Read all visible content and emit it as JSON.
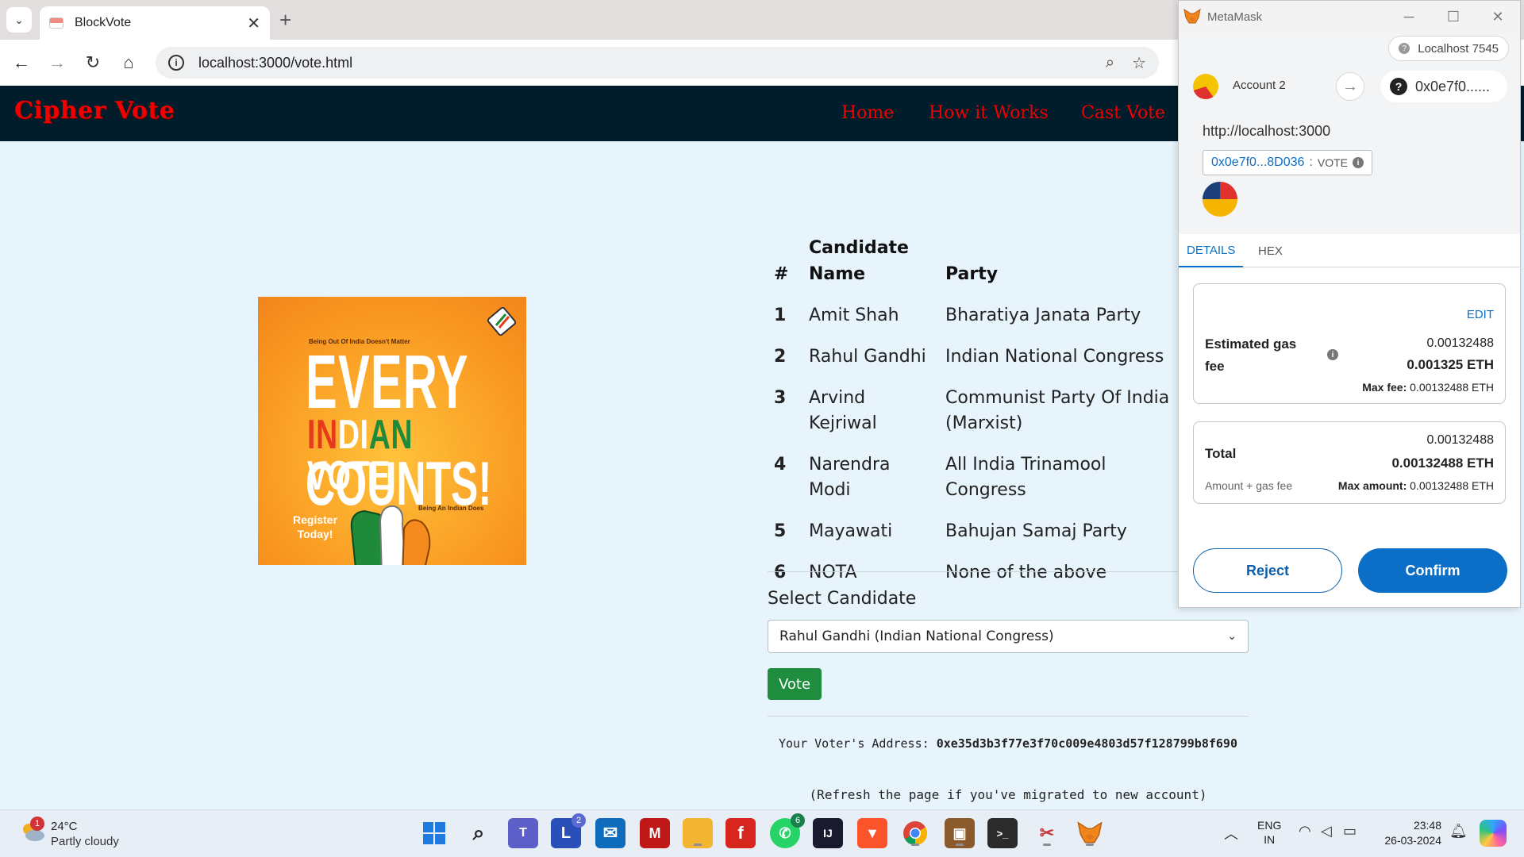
{
  "browser": {
    "tab_title": "BlockVote",
    "url": "localhost:3000/vote.html"
  },
  "site": {
    "brand": "Cipher Vote",
    "nav": [
      "Home",
      "How it Works",
      "Cast Vote"
    ],
    "colors": {
      "nav_bg": "#011c2b",
      "brand": "#f00000",
      "page_bg": "#e8f4fc",
      "vote_btn": "#1e8e3e"
    }
  },
  "poster": {
    "top_small": "Being Out Of India Doesn't Matter",
    "line1": "EVERY",
    "line2_parts": [
      "IN",
      "DI",
      "AN",
      " VOTE"
    ],
    "line3": "COUNTS!",
    "register": "Register\nToday!",
    "bottom_small": "Being An Indian Does"
  },
  "table": {
    "headers": {
      "num": "#",
      "name": "Candidate Name",
      "party": "Party"
    },
    "rows": [
      {
        "num": "1",
        "name": "Amit Shah",
        "party": "Bharatiya Janata Party"
      },
      {
        "num": "2",
        "name": "Rahul Gandhi",
        "party": "Indian National Congress"
      },
      {
        "num": "3",
        "name": "Arvind Kejriwal",
        "party": "Communist Party Of India (Marxist)"
      },
      {
        "num": "4",
        "name": "Narendra Modi",
        "party": "All India Trinamool Congress"
      },
      {
        "num": "5",
        "name": "Mayawati",
        "party": "Bahujan Samaj Party"
      },
      {
        "num": "6",
        "name": "NOTA",
        "party": "None of the above"
      }
    ]
  },
  "form": {
    "select_label": "Select Candidate",
    "selected_value": "Rahul Gandhi (Indian National Congress)",
    "vote_button": "Vote",
    "voter_prefix": "Your Voter's Address: ",
    "voter_address": "0xe35d3b3f77e3f70c009e4803d57f128799b8f690",
    "refresh_note": "(Refresh the page if you've migrated to new account)"
  },
  "metamask": {
    "window_title": "MetaMask",
    "network": "Localhost 7545",
    "account": "Account 2",
    "to_address": "0x0e7f0......",
    "origin": "http://localhost:3000",
    "contract": "0x0e7f0...8D036",
    "method": "VOTE",
    "tabs": [
      "DETAILS",
      "HEX"
    ],
    "edit": "EDIT",
    "gas_label": "Estimated gas fee",
    "gas_value": "0.00132488",
    "gas_eth": "0.001325 ETH",
    "max_fee_label": "Max fee:",
    "max_fee_value": "0.00132488 ETH",
    "total_label": "Total",
    "total_value": "0.00132488",
    "total_eth": "0.00132488 ETH",
    "amount_label": "Amount + gas fee",
    "max_amount_label": "Max amount:",
    "max_amount_value": "0.00132488 ETH",
    "reject": "Reject",
    "confirm": "Confirm",
    "colors": {
      "primary": "#0b6fc7"
    }
  },
  "taskbar": {
    "weather_badge": "1",
    "temperature": "24°C",
    "weather": "Partly cloudy",
    "apps": [
      {
        "name": "windows-start",
        "label": ""
      },
      {
        "name": "search",
        "label": ""
      },
      {
        "name": "teams",
        "label": "T"
      },
      {
        "name": "learning-app",
        "label": "L",
        "badge": "2"
      },
      {
        "name": "mail",
        "label": ""
      },
      {
        "name": "mcafee",
        "label": ""
      },
      {
        "name": "file-explorer",
        "label": ""
      },
      {
        "name": "flowkey",
        "label": "f"
      },
      {
        "name": "whatsapp",
        "label": "",
        "badge": "6"
      },
      {
        "name": "intellij",
        "label": "IJ"
      },
      {
        "name": "brave",
        "label": ""
      },
      {
        "name": "chrome",
        "label": ""
      },
      {
        "name": "package-app",
        "label": ""
      },
      {
        "name": "terminal",
        "label": ">_"
      },
      {
        "name": "snipping-tool",
        "label": ""
      },
      {
        "name": "metamask",
        "label": ""
      }
    ],
    "lang_top": "ENG",
    "lang_bottom": "IN",
    "time": "23:48",
    "date": "26-03-2024"
  }
}
